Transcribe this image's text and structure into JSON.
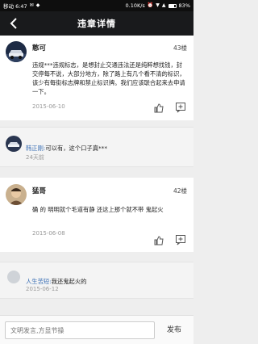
{
  "status_bar": {
    "carrier_time": "移动 6:47",
    "network_speed": "0.10K/s",
    "battery": "83%"
  },
  "nav": {
    "title": "违章详情"
  },
  "comments": [
    {
      "username": "憨可",
      "floor": "43楼",
      "body": "违规***违规标志，是想封止交通违法还是纯粹想找钱，封交停每不说，大部分地方，除了路上有几个看不清的标识，该少有每街标志牌和禁止标识牌。我们应该联合起来去申请一下。",
      "date": "2015-06-10",
      "replies": [
        {
          "name": "韩正刚:",
          "text": "可以有，这个口子真***",
          "date": "24天前"
        }
      ]
    },
    {
      "username": "猛哥",
      "floor": "42楼",
      "body": "确 的 明明就个毛道有静 还这上那个就不带 鬼起火",
      "date": "2015-06-08",
      "replies": [
        {
          "name": "人生苦短:",
          "text": "我还鬼起火的",
          "date": "2015-06-12"
        }
      ]
    }
  ],
  "input": {
    "placeholder": "文明发言,方显节操"
  },
  "send_label": "发布",
  "colors": {
    "nav_bg": "#191a1c",
    "reply_name": "#3a6fb5"
  }
}
